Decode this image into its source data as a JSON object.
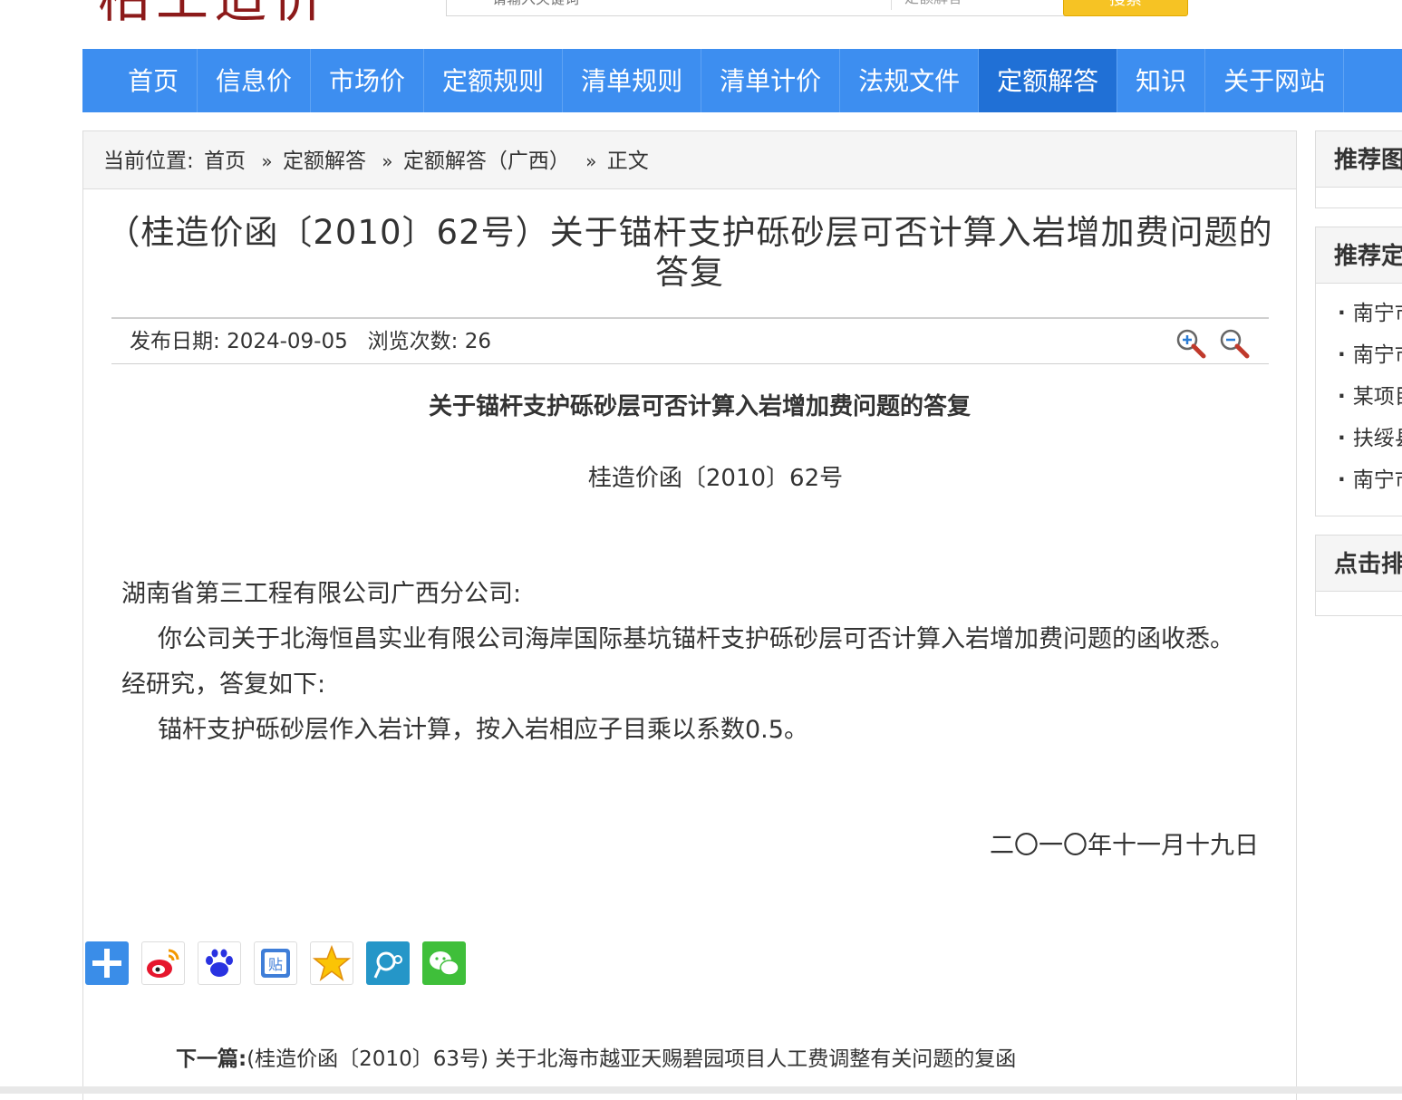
{
  "header": {
    "logo_text": "柏工造价",
    "search_placeholder": "请输入关键词",
    "search_scope": "定额解答",
    "search_button": "搜索"
  },
  "nav": {
    "items": [
      {
        "label": "首页"
      },
      {
        "label": "信息价"
      },
      {
        "label": "市场价"
      },
      {
        "label": "定额规则"
      },
      {
        "label": "清单规则"
      },
      {
        "label": "清单计价"
      },
      {
        "label": "法规文件"
      },
      {
        "label": "定额解答",
        "active": true
      },
      {
        "label": "知识"
      },
      {
        "label": "关于网站"
      }
    ]
  },
  "breadcrumb": {
    "prefix": "当前位置:",
    "items": [
      "首页",
      "定额解答",
      "定额解答（广西）",
      "正文"
    ],
    "separator": "»"
  },
  "article": {
    "title": "（桂造价函〔2010〕62号）关于锚杆支护砾砂层可否计算入岩增加费问题的答复",
    "publish_label": "发布日期:",
    "publish_date": "2024-09-05",
    "views_label": "浏览次数:",
    "views": "26",
    "content_heading": "关于锚杆支护砾砂层可否计算入岩增加费问题的答复",
    "doc_number": "桂造价函〔2010〕62号",
    "salutation": "湖南省第三工程有限公司广西分公司:",
    "paragraph1": "你公司关于北海恒昌实业有限公司海岸国际基坑锚杆支护砾砂层可否计算入岩增加费问题的函收悉。经研究，答复如下:",
    "paragraph2": "锚杆支护砾砂层作入岩计算，按入岩相应子目乘以系数0.5。",
    "date": "二〇一〇年十一月十九日",
    "next_label": "下一篇:",
    "next_title": "(桂造价函〔2010〕63号) 关于北海市越亚天赐碧园项目人工费调整有关问题的复函"
  },
  "share_icons": [
    "share-more-icon",
    "weibo-icon",
    "baidu-icon",
    "tieba-icon",
    "qzone-icon",
    "tqq-icon",
    "wechat-icon"
  ],
  "sidebar": {
    "box1_title": "推荐图",
    "box2_title": "推荐定",
    "box2_items": [
      "南宁市",
      "南宁市",
      "某项目",
      "扶绥县",
      "南宁市"
    ],
    "box3_title": "点击排"
  },
  "colors": {
    "nav_bg": "#3d8ef0",
    "nav_active": "#2070d6",
    "logo": "#8c1a1a",
    "search_button": "#f6c324"
  }
}
